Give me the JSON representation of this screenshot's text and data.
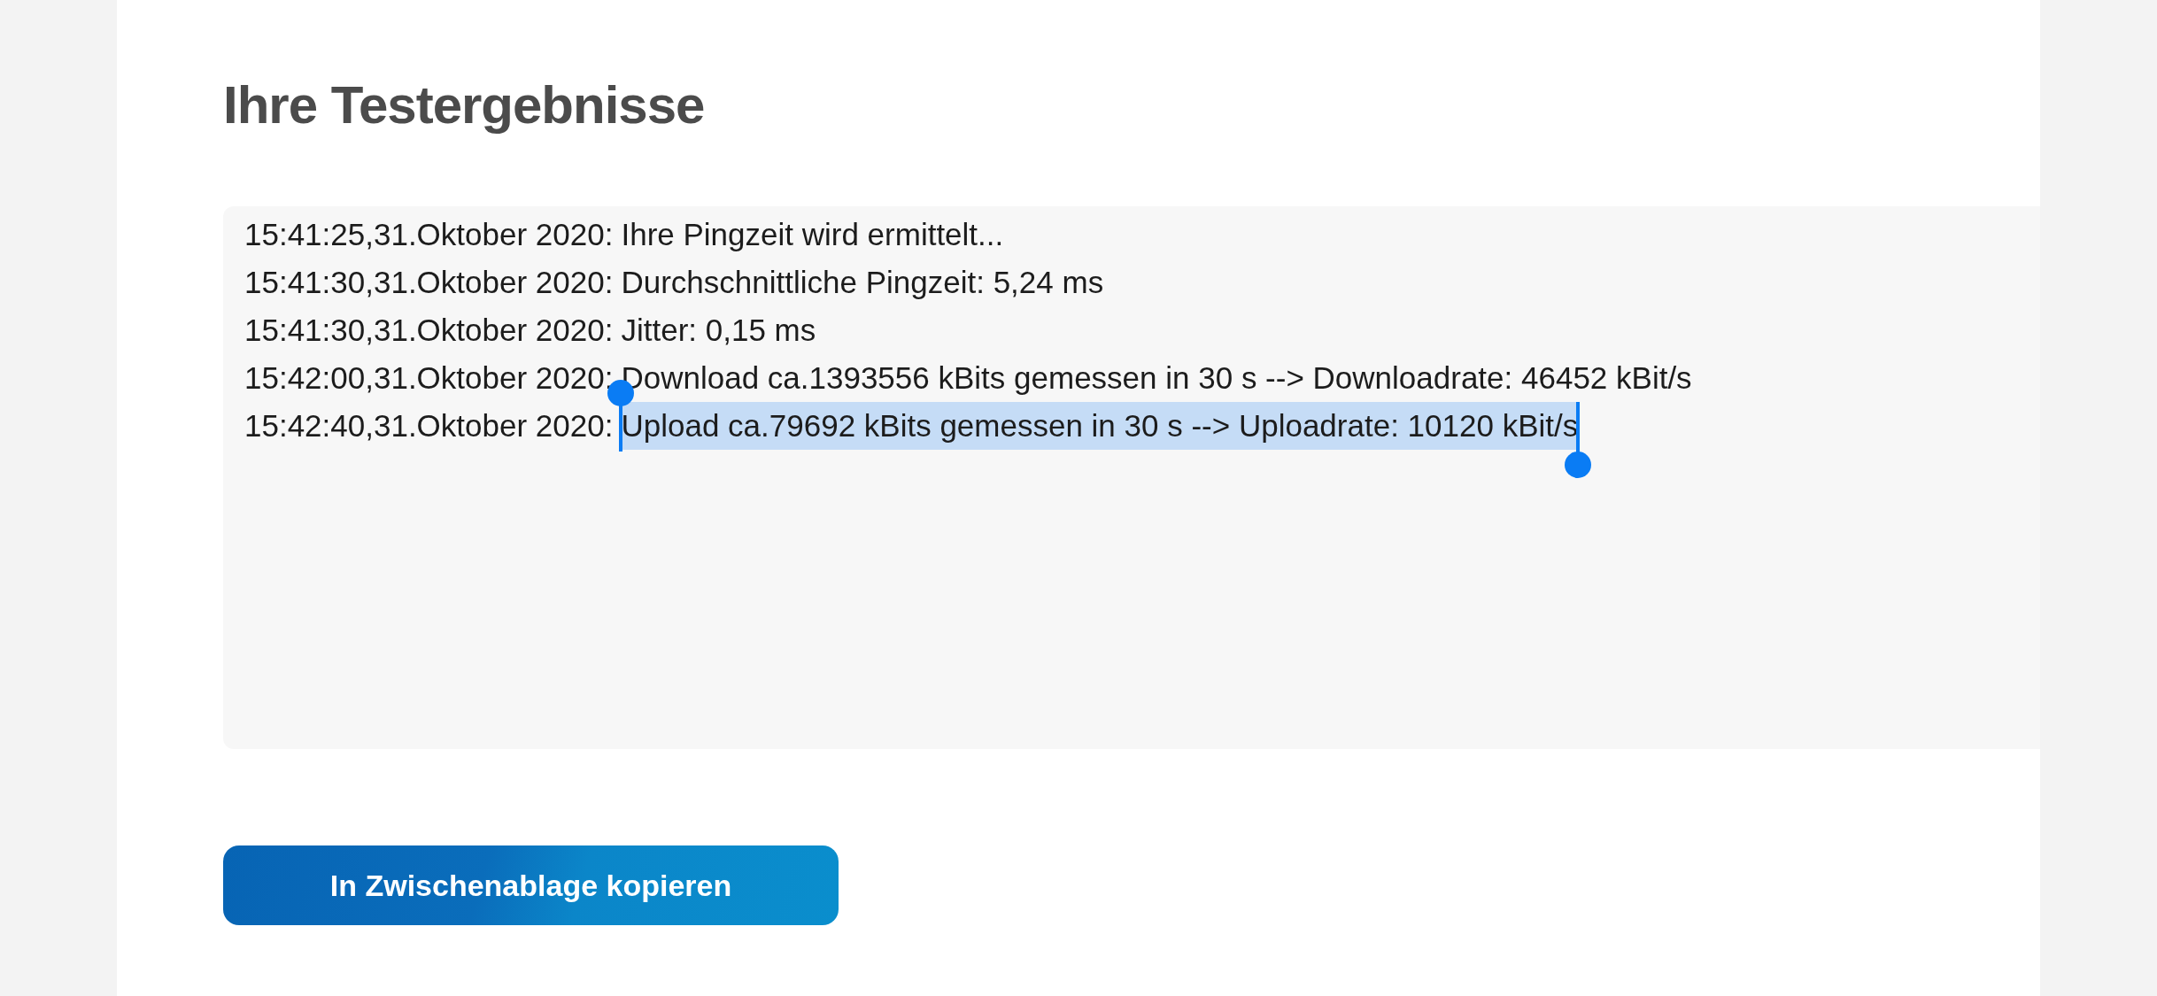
{
  "title": "Ihre Testergebnisse",
  "log": {
    "lines": [
      {
        "timestamp": "15:41:25,31.Oktober 2020:",
        "message": "Ihre Pingzeit wird ermittelt...",
        "selected": false
      },
      {
        "timestamp": "15:41:30,31.Oktober 2020:",
        "message": "Durchschnittliche Pingzeit: 5,24 ms",
        "selected": false
      },
      {
        "timestamp": "15:41:30,31.Oktober 2020:",
        "message": "Jitter: 0,15 ms",
        "selected": false
      },
      {
        "timestamp": "15:42:00,31.Oktober 2020:",
        "message": "Download ca.1393556 kBits gemessen in 30 s --> Downloadrate: 46452 kBit/s",
        "selected": false
      },
      {
        "timestamp": "15:42:40,31.Oktober 2020:",
        "message": "Upload ca.79692 kBits gemessen in 30 s --> Uploadrate: 10120 kBit/s",
        "selected": true
      }
    ]
  },
  "copy_button": {
    "label": "In Zwischenablage kopieren"
  }
}
